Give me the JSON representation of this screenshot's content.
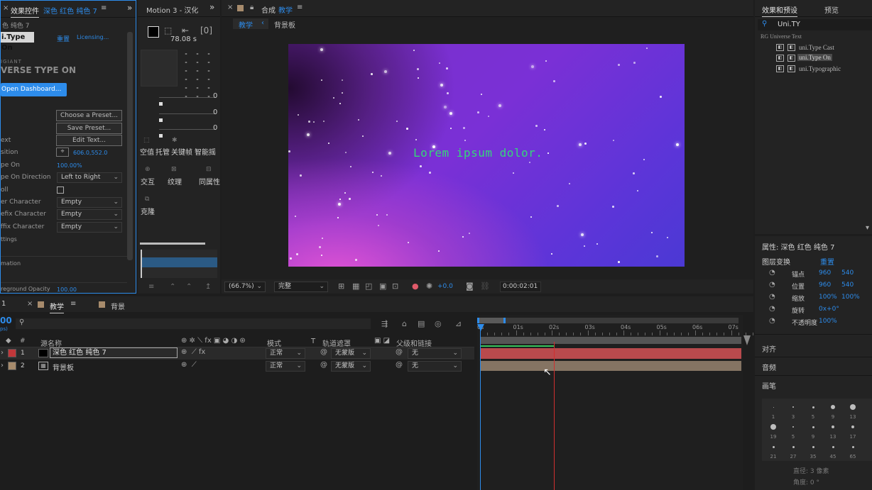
{
  "effect_controls": {
    "tab_label": "效果控件",
    "tab_layer": "深色 红色 纯色 7",
    "layer_sub": "色 纯色 7",
    "effect_name": "i.Type On",
    "reset": "重置",
    "licensing": "Licensing...",
    "brand_top": "IGIANT",
    "brand_main": "VERSE TYPE ON",
    "open_dashboard": "Open Dashboard...",
    "choose_preset": "Choose a Preset...",
    "save_preset": "Save Preset...",
    "edit_text": "Edit Text...",
    "props": [
      {
        "label": "ext",
        "value": ""
      },
      {
        "label": "sition",
        "value": "606.0,552.0"
      },
      {
        "label": "pe On",
        "value": "100.00%"
      },
      {
        "label": "pe On Direction",
        "value": "Left to Right"
      },
      {
        "label": "oll",
        "value": ""
      },
      {
        "label": "er Character",
        "value": "Empty"
      },
      {
        "label": "efix Character",
        "value": "Empty"
      },
      {
        "label": "ffix Character",
        "value": "Empty"
      },
      {
        "label": "ttings",
        "value": ""
      },
      {
        "label": "mation",
        "value": ""
      },
      {
        "label": "reground Opacity",
        "value": "100.00"
      }
    ]
  },
  "motion": {
    "tab_label": "Motion 3 - 汉化",
    "readout": "78.08 s",
    "slider_values": [
      "0",
      "0",
      "0"
    ],
    "tools": [
      {
        "label": "空值",
        "icon": "null-icon"
      },
      {
        "label": "托管",
        "icon": "anchor-icon"
      },
      {
        "label": "关键帧",
        "icon": "keyframe-icon"
      },
      {
        "label": "智能摇",
        "icon": "smart-icon"
      },
      {
        "label": "交互",
        "icon": "interact-icon"
      },
      {
        "label": "纹理",
        "icon": "texture-icon"
      },
      {
        "label": "同属性",
        "icon": "same-prop-icon"
      },
      {
        "label": "克隆",
        "icon": "clone-icon"
      }
    ]
  },
  "composition": {
    "tab_prefix": "合成",
    "tab_name": "教学",
    "crumbs": [
      "教学",
      "背景板"
    ],
    "canvas_text": "Lorem ipsum dolor.",
    "zoom": "(66.7%)",
    "quality": "完整",
    "exposure": "+0.0",
    "timecode": "0:00:02:01"
  },
  "presets": {
    "tabs": [
      "效果和预设",
      "预览"
    ],
    "search": "Uni.TY",
    "group": "RG Universe Text",
    "items": [
      "uni.Type Cast",
      "uni.Type On",
      "uni.Typographic"
    ],
    "selected_index": 1
  },
  "properties": {
    "title": "属性: 深色 红色 纯色 7",
    "section": "图层变换",
    "reset": "重置",
    "rows": [
      {
        "label": "锚点",
        "v1": "960",
        "v2": "540"
      },
      {
        "label": "位置",
        "v1": "960",
        "v2": "540"
      },
      {
        "label": "缩放",
        "v1": "100%",
        "v2": "100%"
      },
      {
        "label": "旋转",
        "v1": "0x+0°",
        "v2": ""
      },
      {
        "label": "不透明度",
        "v1": "100%",
        "v2": ""
      }
    ],
    "align": "对齐",
    "audio": "音频",
    "brush": "画笔",
    "brush_sizes": [
      "1",
      "3",
      "5",
      "9",
      "13",
      "19",
      "5",
      "9",
      "13",
      "17",
      "21",
      "27",
      "35",
      "45",
      "65"
    ],
    "diameter": "直径: 3 像素",
    "angle": "角度: 0 °"
  },
  "timeline": {
    "tabs": [
      "教学",
      "背景"
    ],
    "tc_left": "00",
    "tc_sub": "ps)",
    "search_placeholder": "",
    "col_name": "源名称",
    "col_mode": "模式",
    "col_t": "T",
    "col_track": "轨道遮罩",
    "col_parent": "父级和链接",
    "ruler": [
      "0s",
      "01s",
      "02s",
      "03s",
      "04s",
      "05s",
      "06s",
      "07s"
    ],
    "layers": [
      {
        "num": "1",
        "name": "深色 红色 纯色 7",
        "mode": "正常",
        "track": "无蒙版",
        "parent": "无",
        "color": "#c1373a"
      },
      {
        "num": "2",
        "name": "背景板",
        "mode": "正常",
        "track": "无蒙版",
        "parent": "无",
        "color": "#a78b6c"
      }
    ]
  }
}
